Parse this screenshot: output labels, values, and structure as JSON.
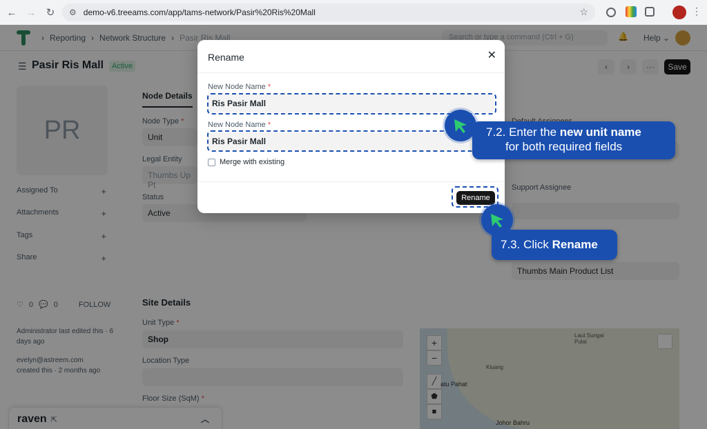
{
  "browser": {
    "url": "demo-v6.treeams.com/app/tams-network/Pasir%20Ris%20Mall"
  },
  "topbar": {
    "breadcrumbs": [
      "Reporting",
      "Network Structure",
      "Pasir Ris Mall"
    ],
    "command_placeholder": "Search or type a command (Ctrl + G)",
    "help_label": "Help"
  },
  "page": {
    "title": "Pasir Ris Mall",
    "status": "Active",
    "save_label": "Save",
    "more_label": "···"
  },
  "sidebar": {
    "avatar_initials": "PR",
    "items": [
      {
        "label": "Assigned To"
      },
      {
        "label": "Attachments"
      },
      {
        "label": "Tags"
      },
      {
        "label": "Share"
      }
    ],
    "likes": "0",
    "comments": "0",
    "follow_label": "FOLLOW",
    "edited_by": "Administrator last edited this · 6 days ago",
    "created_by_email": "evelyn@astreem.com",
    "created_ago": "created this · 2 months ago"
  },
  "form": {
    "tab": "Node Details",
    "node_type_label": "Node Type",
    "node_type_value": "Unit",
    "legal_entity_label": "Legal Entity",
    "legal_entity_value": "Thumbs Up Pt",
    "status_label": "Status",
    "status_value": "Active",
    "default_assignees_label": "Default Assignees",
    "support_assignee_label": "Support Assignee",
    "product_list_value": "Thumbs Main Product List",
    "site_section": "Site Details",
    "unit_type_label": "Unit Type",
    "unit_type_value": "Shop",
    "location_type_label": "Location Type",
    "floor_size_label": "Floor Size (SqM)"
  },
  "map": {
    "labels": [
      "Laut Sungai Pulai",
      "Kluang",
      "atu Pahat",
      "Johor Bahru"
    ]
  },
  "raven": {
    "label": "raven"
  },
  "modal": {
    "title": "Rename",
    "field1_label": "New Node Name",
    "field1_value": "Ris Pasir Mall",
    "field2_label": "New Node Name",
    "field2_value": "Ris Pasir Mall",
    "merge_label": "Merge with existing",
    "rename_button": "Rename"
  },
  "annotations": {
    "step2_prefix": "7.2. Enter the ",
    "step2_bold": "new unit name",
    "step2_suffix": "for both required fields",
    "step3_prefix": "7.3. Click ",
    "step3_bold": "Rename"
  },
  "colors": {
    "annotation_blue": "#1a4fb0",
    "cursor_green": "#2ecc71",
    "primary_dark": "#171717"
  }
}
